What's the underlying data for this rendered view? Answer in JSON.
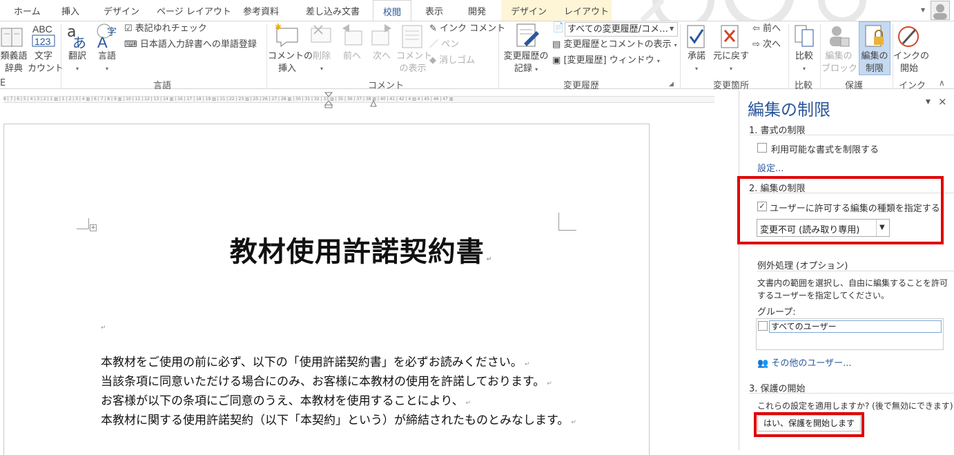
{
  "tabs": [
    "ホーム",
    "挿入",
    "デザイン",
    "ページ レイアウト",
    "参考資料",
    "差し込み文書",
    "校閲",
    "表示",
    "開発",
    "デザイン",
    "レイアウト"
  ],
  "active_tab": "校閲",
  "ribbon": {
    "proofing": {
      "thesaurus": [
        "類義語",
        "辞典"
      ],
      "wordcount": [
        "文字",
        "カウント"
      ]
    },
    "language": {
      "translate": "翻訳",
      "language": "言語",
      "consistency": "表記ゆれチェック",
      "ime_dict": "日本語入力辞書への単語登録",
      "group": "言語"
    },
    "comments": {
      "new": [
        "コメントの",
        "挿入"
      ],
      "delete": "削除",
      "prev": "前へ",
      "next": "次へ",
      "show": [
        "コメント",
        "の表示"
      ],
      "ink": "インク コメント",
      "pen": "ペン",
      "eraser": "消しゴム",
      "group": "コメント"
    },
    "tracking": {
      "track": [
        "変更履歴の",
        "記録"
      ],
      "display_select": "すべての変更履歴/コメ…",
      "show_markup": "変更履歴とコメントの表示",
      "pane": "[変更履歴] ウィンドウ",
      "group": "変更履歴"
    },
    "changes": {
      "accept": "承諾",
      "reject": "元に戻す",
      "prev": "前へ",
      "next": "次へ",
      "group": "変更箇所"
    },
    "compare": {
      "compare": "比較",
      "group": "比較"
    },
    "protect": {
      "block": [
        "編集の",
        "ブロック"
      ],
      "restrict": [
        "編集の",
        "制限"
      ],
      "group": "保護"
    },
    "ink": {
      "start": [
        "インクの",
        "開始"
      ],
      "group": "インク"
    }
  },
  "ruler_text": "8 | 7 | 6 | 5 | 4 | 3 | 2 | 1 ▥ | 1 | 2 | 3 | 4 ▥ | 6 | 7 | 8 | 9 ▥ | 10 | 11 | 12 | 13 | 14 ▥ | 16 | 17 | 18 | 19 ▥ | 21 | 22 | 23 ▥ | 25 | 26 | 27 | 28 ▥ | 30 | 31 | 32 | 33 ▥ | 35 | 36 | 37 | 38 ▥ | 40 | 41 | 42 | 4 ▥ 4 | 45 | 46 | 47 ▥",
  "document": {
    "title": "教材使用許諾契約書",
    "lines": [
      "本教材をご使用の前に必ず、以下の「使用許諾契約書」を必ずお読みください。",
      "当該条項に同意いただける場合にのみ、お客様に本教材の使用を許諾しております。",
      "お客様が以下の条項にご同意のうえ、本教材を使用することにより、",
      "本教材に関する使用許諾契約（以下「本契約」という）が締結されたものとみなします。"
    ]
  },
  "pane": {
    "title": "編集の制限",
    "sec1": "1. 書式の制限",
    "sec1_check": "利用可能な書式を制限する",
    "sec1_link": "設定...",
    "sec2": "2. 編集の制限",
    "sec2_check": "ユーザーに許可する編集の種類を指定する:",
    "sec2_select": "変更不可 (読み取り専用)",
    "exceptions_head": "例外処理 (オプション)",
    "exceptions_desc1": "文書内の範囲を選択し、自由に編集することを許可",
    "exceptions_desc2": "するユーザーを指定してください。",
    "groups_label": "グループ:",
    "groups_item": "すべてのユーザー",
    "more_users": "その他のユーザー...",
    "sec3": "3. 保護の開始",
    "sec3_question": "これらの設定を適用しますか? (後で無効にできます)",
    "sec3_button": "はい、保護を開始します"
  },
  "colors": {
    "accent": "#2b579a",
    "highlight_red": "#e00000",
    "context_tab": "#fdf5d6"
  }
}
